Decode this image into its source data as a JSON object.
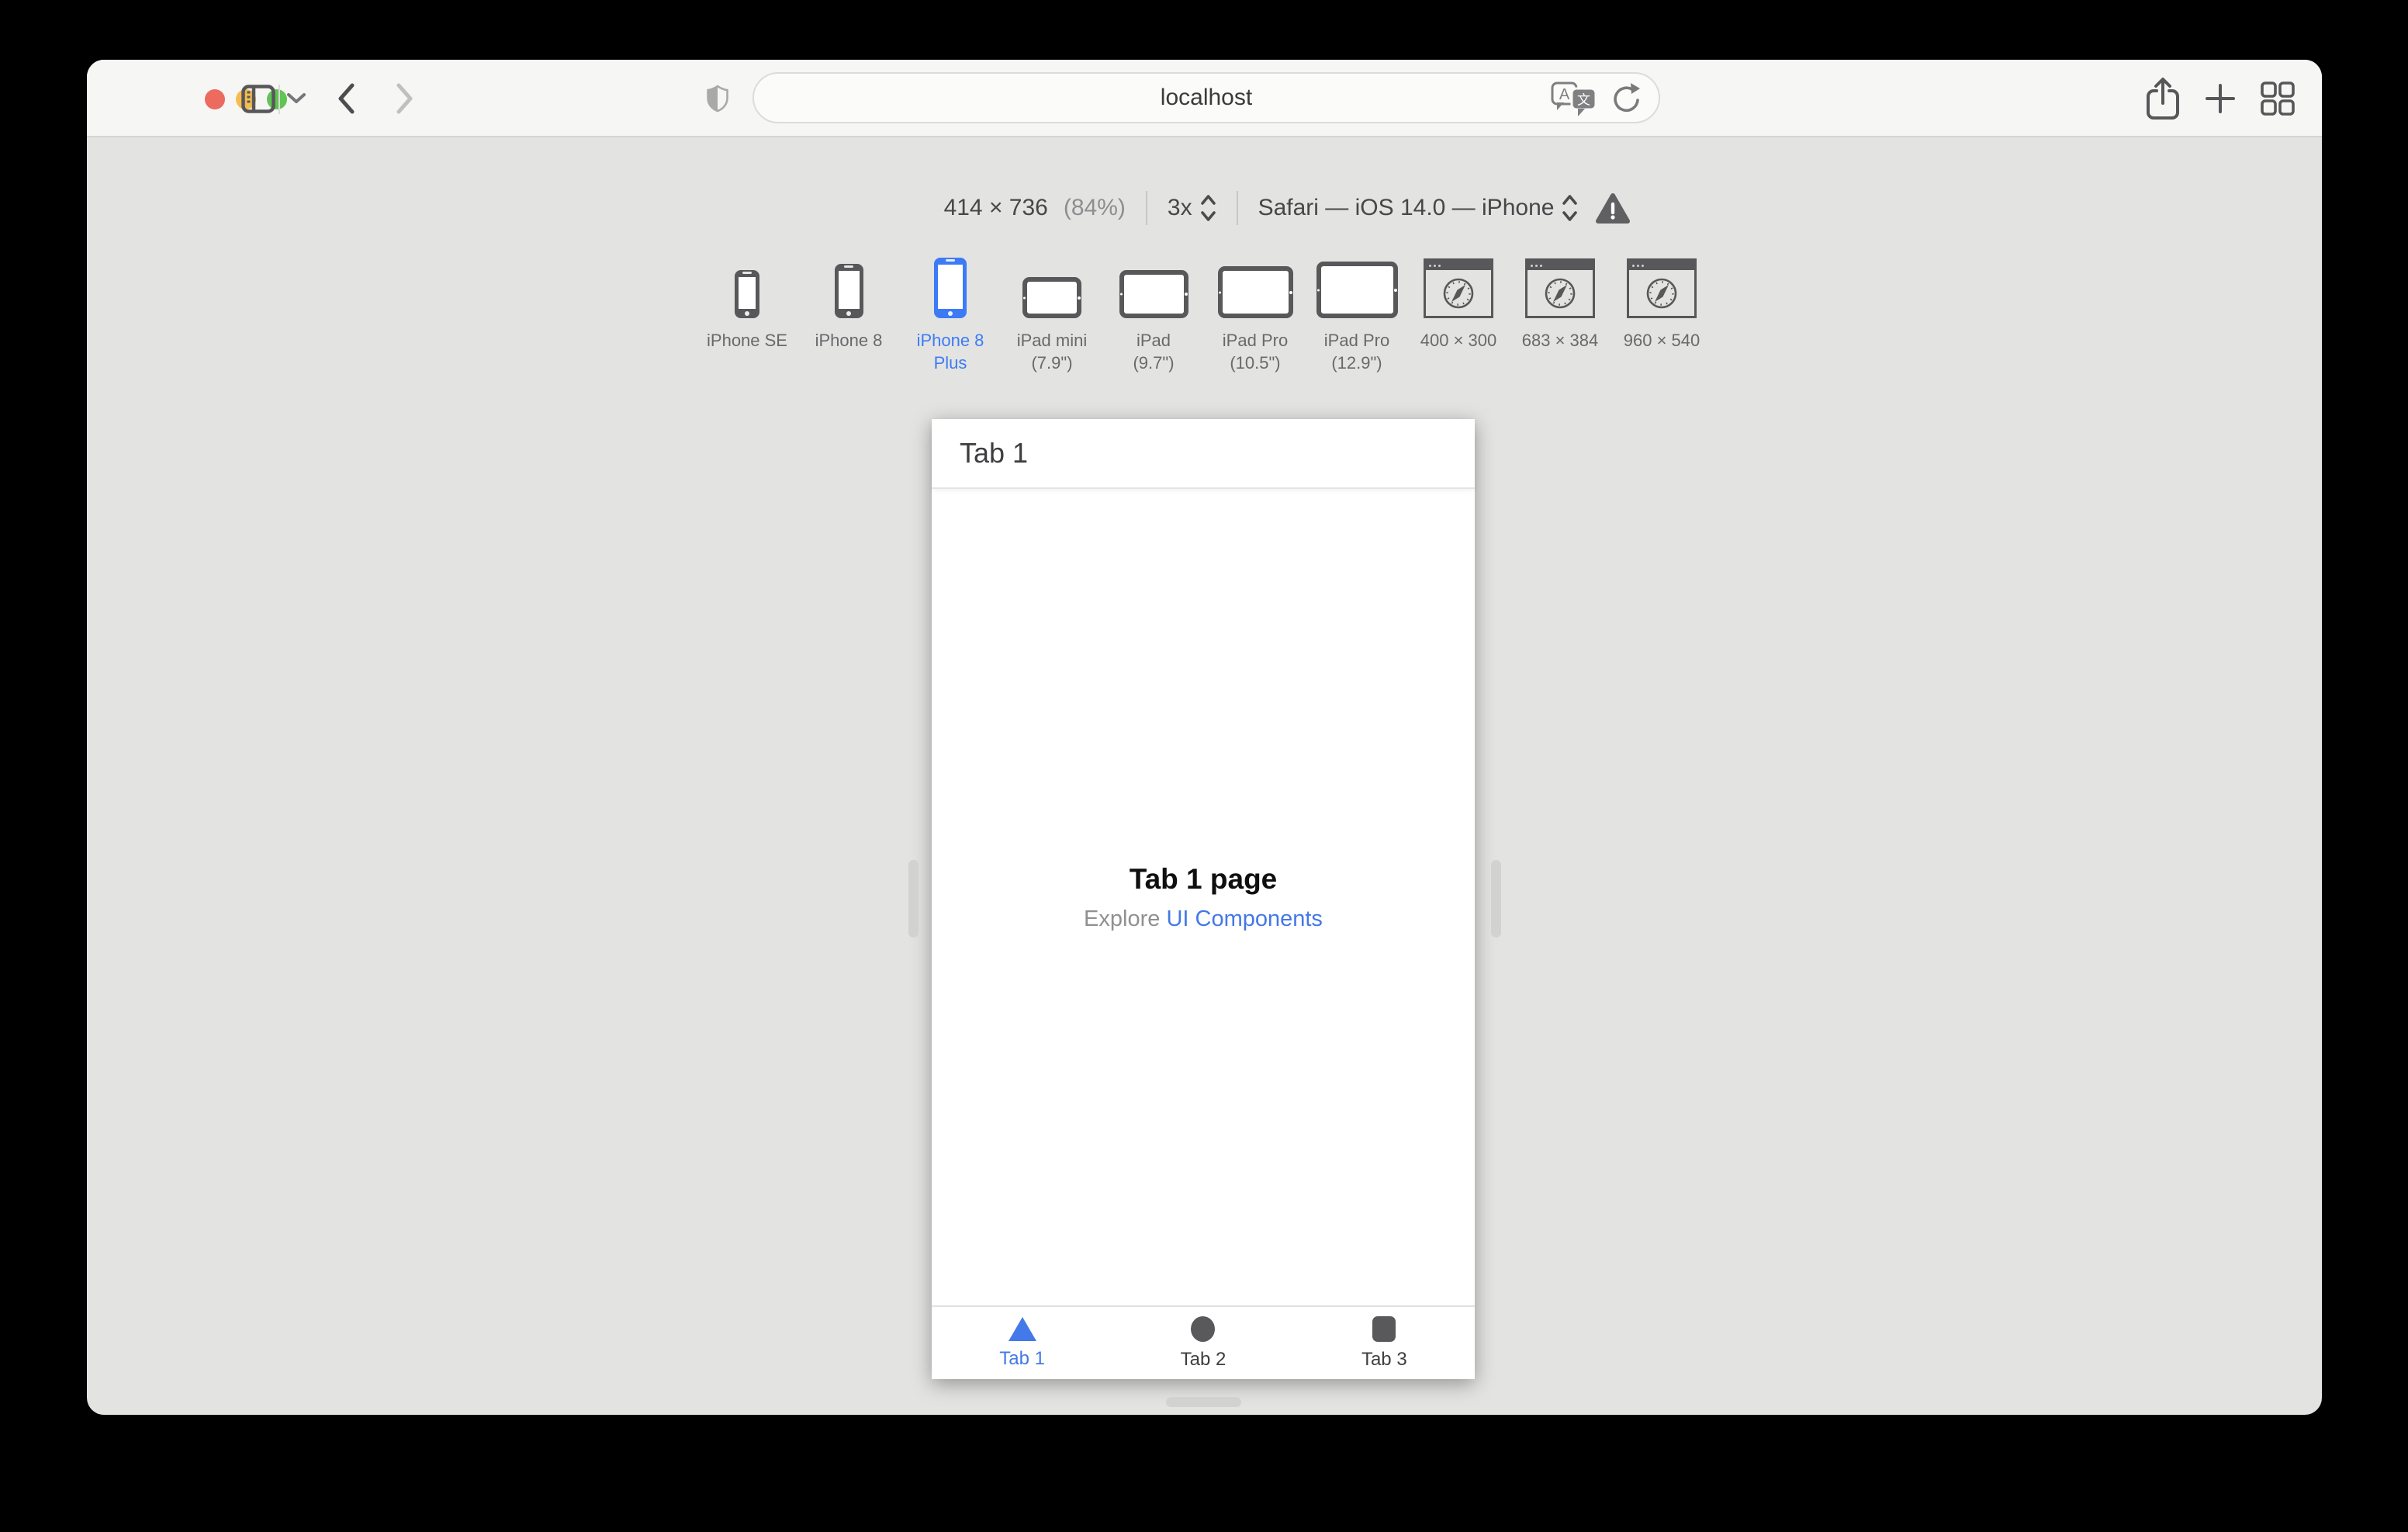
{
  "toolbar": {
    "url": "localhost",
    "traffic_lights": [
      "close",
      "minimize",
      "zoom"
    ],
    "icons": [
      "sidebar-toggle",
      "tab-group-chevron",
      "back",
      "forward",
      "privacy-shield",
      "translate",
      "reload",
      "share",
      "new-tab",
      "tab-overview"
    ]
  },
  "simulator_bar": {
    "size": "414 × 736",
    "zoom_percent": "(84%)",
    "pixel_ratio": "3x",
    "user_agent": "Safari — iOS 14.0 — iPhone",
    "warning_icon": "warning-triangle"
  },
  "devices": [
    {
      "line1": "iPhone SE",
      "line2": "",
      "kind": "phone",
      "selected": false
    },
    {
      "line1": "iPhone 8",
      "line2": "",
      "kind": "phone",
      "selected": false
    },
    {
      "line1": "iPhone 8",
      "line2": "Plus",
      "kind": "phone",
      "selected": true
    },
    {
      "line1": "iPad mini",
      "line2": "(7.9\")",
      "kind": "tablet",
      "selected": false
    },
    {
      "line1": "iPad",
      "line2": "(9.7\")",
      "kind": "tablet",
      "selected": false
    },
    {
      "line1": "iPad Pro",
      "line2": "(10.5\")",
      "kind": "tablet",
      "selected": false
    },
    {
      "line1": "iPad Pro",
      "line2": "(12.9\")",
      "kind": "tablet",
      "selected": false
    },
    {
      "line1": "400 × 300",
      "line2": "",
      "kind": "browser-window",
      "selected": false
    },
    {
      "line1": "683 × 384",
      "line2": "",
      "kind": "browser-window",
      "selected": false
    },
    {
      "line1": "960 × 540",
      "line2": "",
      "kind": "browser-window",
      "selected": false
    }
  ],
  "preview": {
    "nav_title": "Tab 1",
    "page_heading": "Tab 1 page",
    "subtitle_prefix": "Explore",
    "subtitle_link": "UI Components",
    "tab_bar": [
      {
        "label": "Tab 1",
        "icon": "triangle",
        "active": true
      },
      {
        "label": "Tab 2",
        "icon": "circle",
        "active": false
      },
      {
        "label": "Tab 3",
        "icon": "square",
        "active": false
      }
    ]
  },
  "colors": {
    "selection_blue": "#3D7BF5",
    "link_blue": "#4478E8",
    "tab_active_blue": "#4379E8",
    "traffic_red": "#EC6A5E",
    "traffic_yellow": "#F5BD4F",
    "traffic_green": "#61C454",
    "toolbar_bg": "#F6F6F5",
    "canvas_bg": "#E3E3E2",
    "icon_gray": "#58585A"
  }
}
